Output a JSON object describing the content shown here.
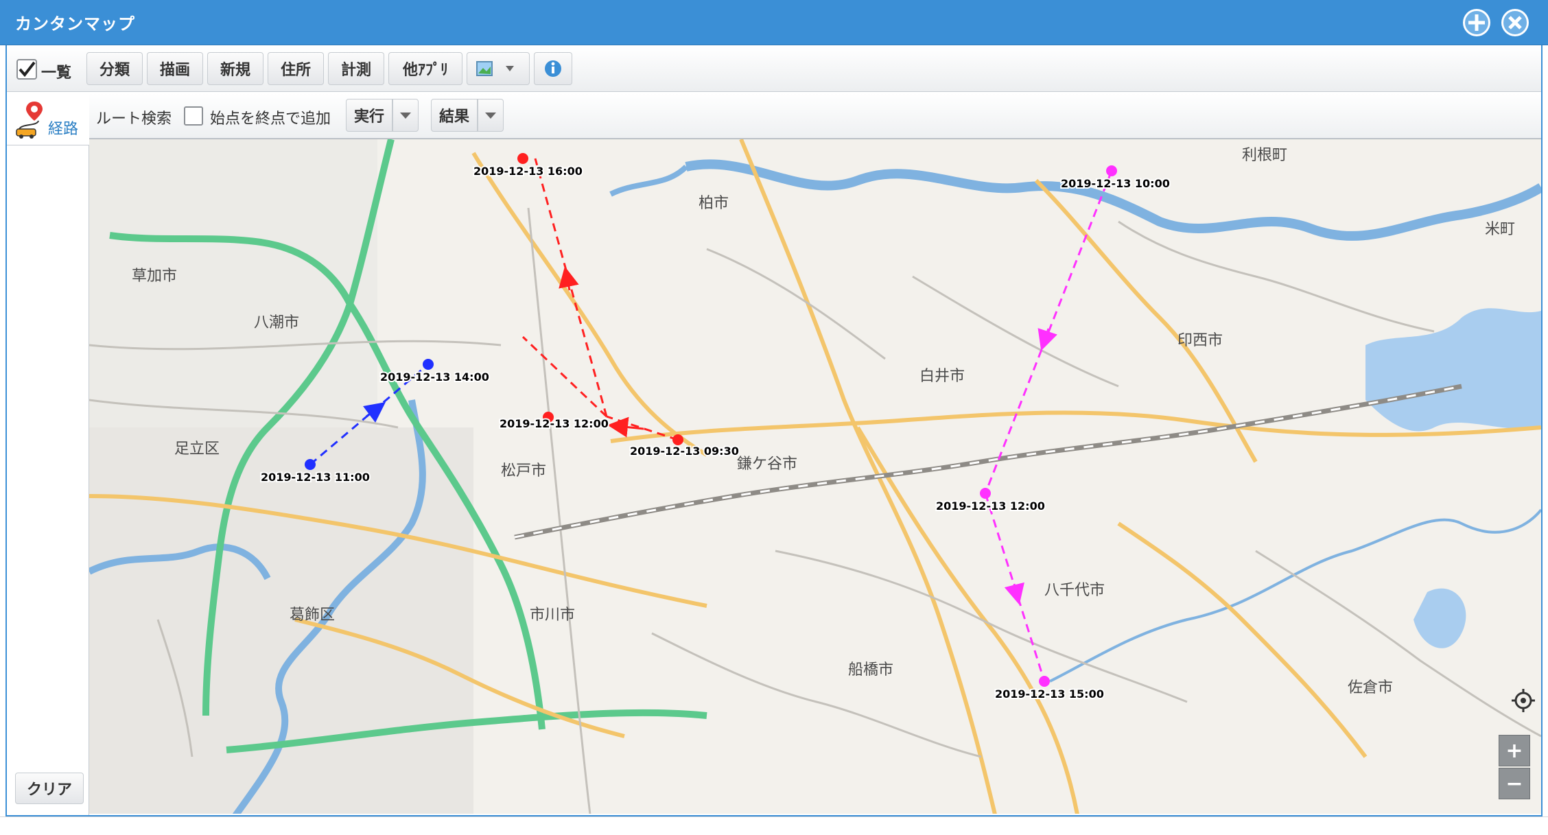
{
  "window": {
    "title": "カンタンマップ",
    "add_icon": "plus-circle-icon",
    "close_icon": "close-circle-icon"
  },
  "toolbar": {
    "list_checked": true,
    "list_label": "一覧",
    "buttons": [
      "分類",
      "描画",
      "新規",
      "住所",
      "計測",
      "他ｱﾌﾟﾘ"
    ],
    "image_icon": "image-icon",
    "info_icon": "info-icon"
  },
  "left_panel": {
    "route_label": "経路",
    "route_icon": "route-car-icon",
    "clear_label": "クリア"
  },
  "route_bar": {
    "title": "ルート検索",
    "checkbox_checked": false,
    "checkbox_label": "始点を終点で追加",
    "run_label": "実行",
    "result_label": "結果"
  },
  "map": {
    "colors": {
      "red": "#ff2020",
      "blue": "#2030ff",
      "magenta": "#ff30ff",
      "green_road": "#5cc98c",
      "river": "#7fb2e0"
    },
    "places": [
      "柏市",
      "利根町",
      "米町",
      "印西市",
      "白井市",
      "草加市",
      "八潮市",
      "足立区",
      "松戸市",
      "鎌ケ谷市",
      "八千代市",
      "船橋市",
      "市川市",
      "葛飾区",
      "佐倉市"
    ],
    "routes": [
      {
        "color": "red",
        "points": [
          {
            "label": "2019-12-13 09:30"
          },
          {
            "label": "2019-12-13 12:00"
          },
          {
            "label": "2019-12-13 16:00"
          }
        ]
      },
      {
        "color": "blue",
        "points": [
          {
            "label": "2019-12-13 11:00"
          },
          {
            "label": "2019-12-13 14:00"
          }
        ]
      },
      {
        "color": "magenta",
        "points": [
          {
            "label": "2019-12-13 10:00"
          },
          {
            "label": "2019-12-13 12:00"
          },
          {
            "label": "2019-12-13 15:00"
          }
        ]
      }
    ],
    "zoom_in": "+",
    "zoom_out": "−",
    "locate_icon": "crosshair-icon"
  }
}
